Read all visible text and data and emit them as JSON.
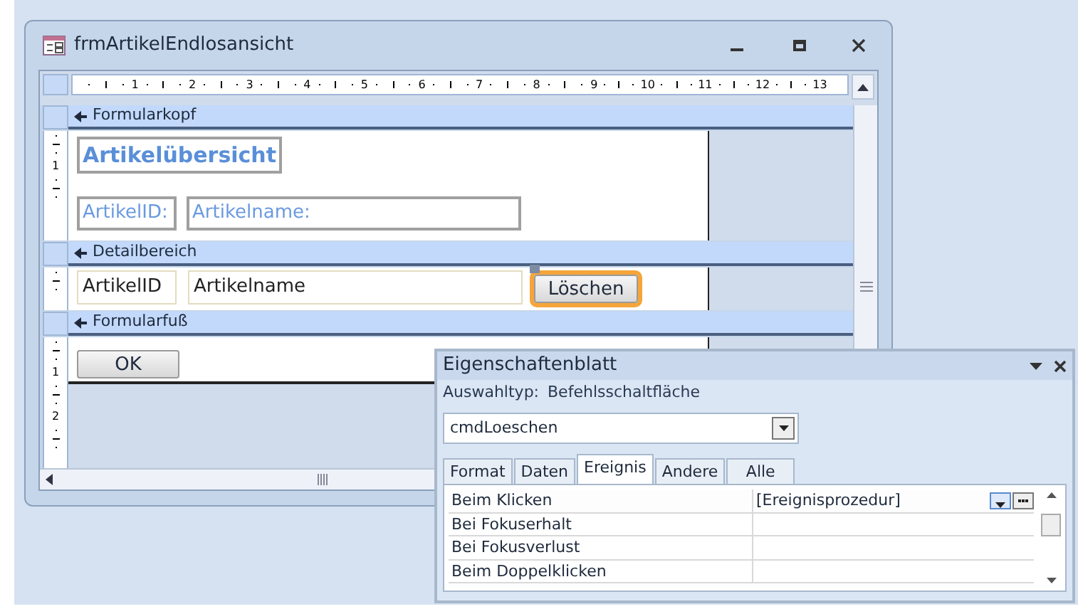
{
  "form_window": {
    "title": "frmArtikelEndlosansicht",
    "ruler_numbers": [
      "1",
      "2",
      "3",
      "4",
      "5",
      "6",
      "7",
      "8",
      "9",
      "10",
      "11",
      "12",
      "13"
    ],
    "sections": [
      {
        "kind": "header",
        "title": "Formularkopf",
        "vertical_ruler": [
          "1"
        ],
        "controls": [
          {
            "kind": "title_label",
            "text": "Artikelübersicht",
            "selected": false
          },
          {
            "kind": "label",
            "text": "ArtikelID:",
            "selected": false
          },
          {
            "kind": "label",
            "text": "Artikelname:",
            "selected": false
          }
        ]
      },
      {
        "kind": "detail",
        "title": "Detailbereich",
        "controls": [
          {
            "kind": "textbox",
            "text": "ArtikelID",
            "selected": false
          },
          {
            "kind": "textbox",
            "text": "Artikelname",
            "selected": false
          },
          {
            "kind": "button",
            "text": "Löschen",
            "selected": true
          }
        ]
      },
      {
        "kind": "footer",
        "title": "Formularfuß",
        "vertical_ruler": [
          "1",
          "2"
        ],
        "controls": [
          {
            "kind": "button",
            "text": "OK",
            "selected": false
          }
        ]
      }
    ]
  },
  "property_sheet": {
    "title": "Eigenschaftenblatt",
    "selection_type_label": "Auswahltyp:",
    "selection_type": "Befehlsschaltfläche",
    "object_name": "cmdLoeschen",
    "tabs": [
      {
        "label": "Format",
        "selected": false
      },
      {
        "label": "Daten",
        "selected": false
      },
      {
        "label": "Ereignis",
        "selected": true
      },
      {
        "label": "Andere",
        "selected": false
      },
      {
        "label": "Alle",
        "selected": false
      }
    ],
    "rows": [
      {
        "name": "Beim Klicken",
        "value": "[Ereignisprozedur]",
        "selected": true
      },
      {
        "name": "Bei Fokuserhalt",
        "selected": false
      },
      {
        "name": "Bei Fokusverlust",
        "selected": false
      },
      {
        "name": "Beim Doppelklicken",
        "selected": false
      }
    ]
  }
}
